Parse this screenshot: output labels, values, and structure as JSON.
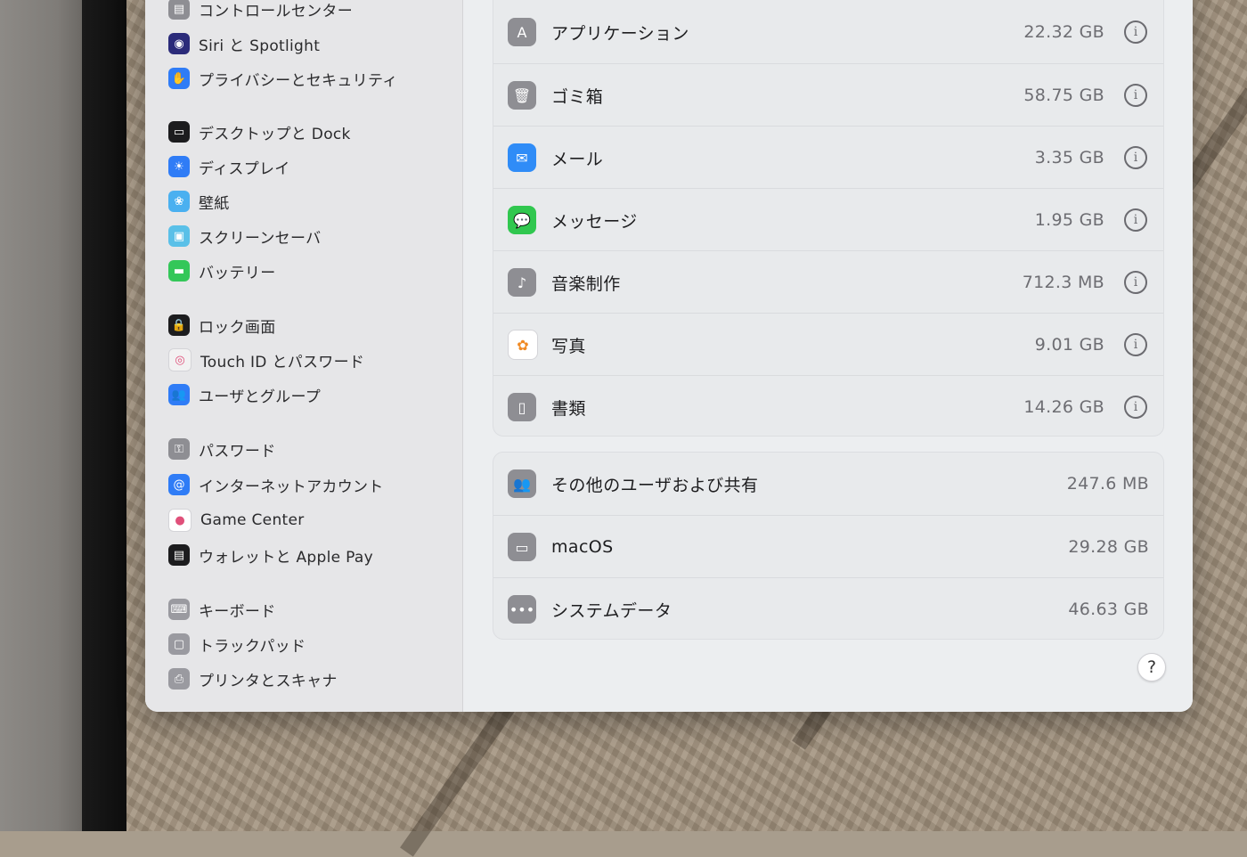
{
  "sidebar": {
    "items": [
      {
        "label": "コントロールセンター",
        "icon": "control-center-icon",
        "color": "#8e8e93",
        "glyph": "▤"
      },
      {
        "label": "Siri と Spotlight",
        "icon": "siri-icon",
        "color": "#2b2b7a",
        "glyph": "◉"
      },
      {
        "label": "プライバシーとセキュリティ",
        "icon": "hand-icon",
        "color": "#2f7cf6",
        "glyph": "✋"
      },
      {
        "label": "デスクトップと Dock",
        "icon": "dock-icon",
        "color": "#1c1c1e",
        "glyph": "▭"
      },
      {
        "label": "ディスプレイ",
        "icon": "display-icon",
        "color": "#2f7cf6",
        "glyph": "☀"
      },
      {
        "label": "壁紙",
        "icon": "wallpaper-icon",
        "color": "#4ab0f0",
        "glyph": "❀"
      },
      {
        "label": "スクリーンセーバ",
        "icon": "screensaver-icon",
        "color": "#5ac0e8",
        "glyph": "▣"
      },
      {
        "label": "バッテリー",
        "icon": "battery-icon",
        "color": "#34c759",
        "glyph": "▬"
      },
      {
        "label": "ロック画面",
        "icon": "lock-icon",
        "color": "#1c1c1e",
        "glyph": "🔒"
      },
      {
        "label": "Touch ID とパスワード",
        "icon": "fingerprint-icon",
        "color": "#f2f2f2",
        "glyph": "◎"
      },
      {
        "label": "ユーザとグループ",
        "icon": "users-icon",
        "color": "#2f7cf6",
        "glyph": "👥"
      },
      {
        "label": "パスワード",
        "icon": "key-icon",
        "color": "#8e8e93",
        "glyph": "⚿"
      },
      {
        "label": "インターネットアカウント",
        "icon": "at-icon",
        "color": "#2f7cf6",
        "glyph": "@"
      },
      {
        "label": "Game Center",
        "icon": "game-center-icon",
        "color": "#ffffff",
        "glyph": "●"
      },
      {
        "label": "ウォレットと Apple Pay",
        "icon": "wallet-icon",
        "color": "#1c1c1e",
        "glyph": "▤"
      },
      {
        "label": "キーボード",
        "icon": "keyboard-icon",
        "color": "#9a9aa0",
        "glyph": "⌨"
      },
      {
        "label": "トラックパッド",
        "icon": "trackpad-icon",
        "color": "#9a9aa0",
        "glyph": "▢"
      },
      {
        "label": "プリンタとスキャナ",
        "icon": "printer-icon",
        "color": "#9a9aa0",
        "glyph": "⎙"
      }
    ]
  },
  "storage": {
    "apps": [
      {
        "label": "アプリケーション",
        "size": "22.32 GB",
        "icon": "app-store-icon",
        "color": "#8e8e93",
        "glyph": "A"
      },
      {
        "label": "ゴミ箱",
        "size": "58.75 GB",
        "icon": "trash-icon",
        "color": "#8e8e93",
        "glyph": "🗑"
      },
      {
        "label": "メール",
        "size": "3.35 GB",
        "icon": "mail-icon",
        "color": "#2f8cf7",
        "glyph": "✉"
      },
      {
        "label": "メッセージ",
        "size": "1.95 GB",
        "icon": "messages-icon",
        "color": "#30c74f",
        "glyph": "💬"
      },
      {
        "label": "音楽制作",
        "size": "712.3 MB",
        "icon": "music-creation-icon",
        "color": "#8e8e93",
        "glyph": "♪"
      },
      {
        "label": "写真",
        "size": "9.01 GB",
        "icon": "photos-icon",
        "color": "#ffffff",
        "glyph": "✿"
      },
      {
        "label": "書類",
        "size": "14.26 GB",
        "icon": "document-icon",
        "color": "#8e8e93",
        "glyph": "▯"
      }
    ],
    "system": [
      {
        "label": "その他のユーザおよび共有",
        "size": "247.6 MB",
        "icon": "users-icon",
        "color": "#8e8e93",
        "glyph": "👥"
      },
      {
        "label": "macOS",
        "size": "29.28 GB",
        "icon": "laptop-icon",
        "color": "#8e8e93",
        "glyph": "▭"
      },
      {
        "label": "システムデータ",
        "size": "46.63 GB",
        "icon": "ellipsis-icon",
        "color": "#8e8e93",
        "glyph": "•••"
      }
    ],
    "info_glyph": "i",
    "help_glyph": "?"
  }
}
